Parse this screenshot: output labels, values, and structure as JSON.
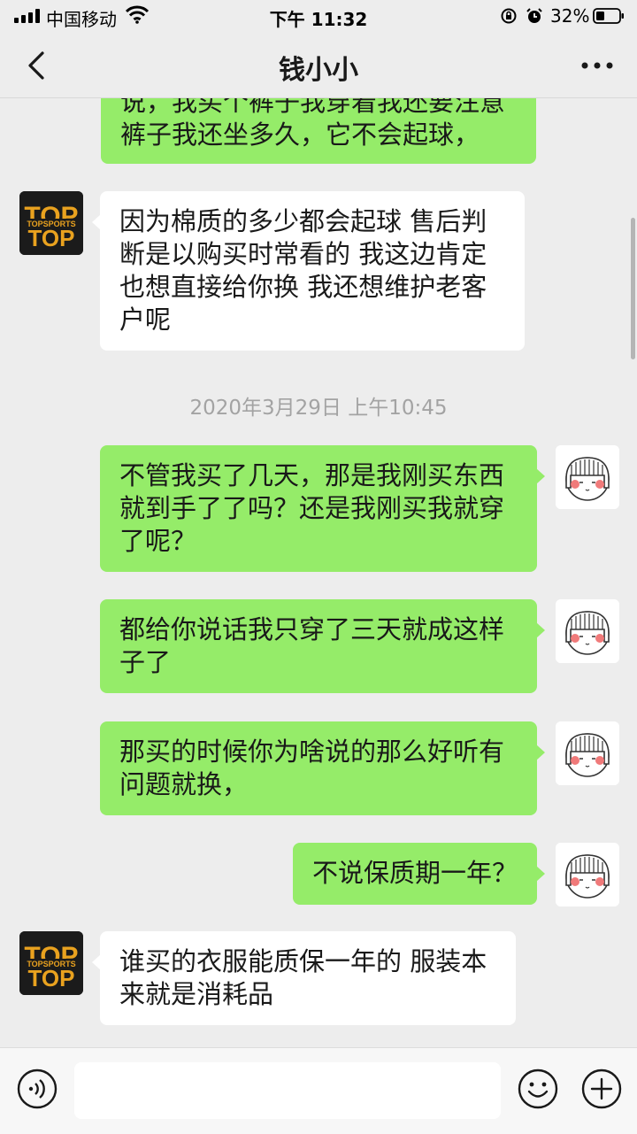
{
  "status_bar": {
    "carrier": "中国移动",
    "time": "下午 11:32",
    "battery": "32%"
  },
  "header": {
    "title": "钱小小"
  },
  "messages": [
    {
      "side": "out",
      "text": "说，我买个裤子我穿着我还要注意裤子我还坐多久，它不会起球，"
    },
    {
      "side": "in",
      "avatar": "TOP",
      "avatar_sub": "TOPSPORTS",
      "text": "因为棉质的多少都会起球  售后判断是以购买时常看的 我这边肯定也想直接给你换 我还想维护老客户呢"
    },
    {
      "side": "out",
      "text": "不管我买了几天，那是我刚买东西就到手了了吗？还是我刚买我就穿了呢？"
    },
    {
      "side": "out",
      "text": "都给你说话我只穿了三天就成这样子了"
    },
    {
      "side": "out",
      "text": "那买的时候你为啥说的那么好听有问题就换，"
    },
    {
      "side": "out",
      "text": "不说保质期一年？"
    },
    {
      "side": "in",
      "avatar": "TOP",
      "avatar_sub": "TOPSPORTS",
      "text": "谁买的衣服能质保一年的 服装本来就是消耗品"
    }
  ],
  "timestamp": "2020年3月29日 上午10:45",
  "input": {
    "placeholder": ""
  },
  "icons": {
    "back": "chevron-left-icon",
    "more": "more-dots-icon",
    "voice": "voice-icon",
    "emoji": "emoji-icon",
    "plus": "plus-icon"
  },
  "colors": {
    "outgoing_bubble": "#95ec69",
    "incoming_bubble": "#ffffff",
    "background": "#ededed"
  }
}
